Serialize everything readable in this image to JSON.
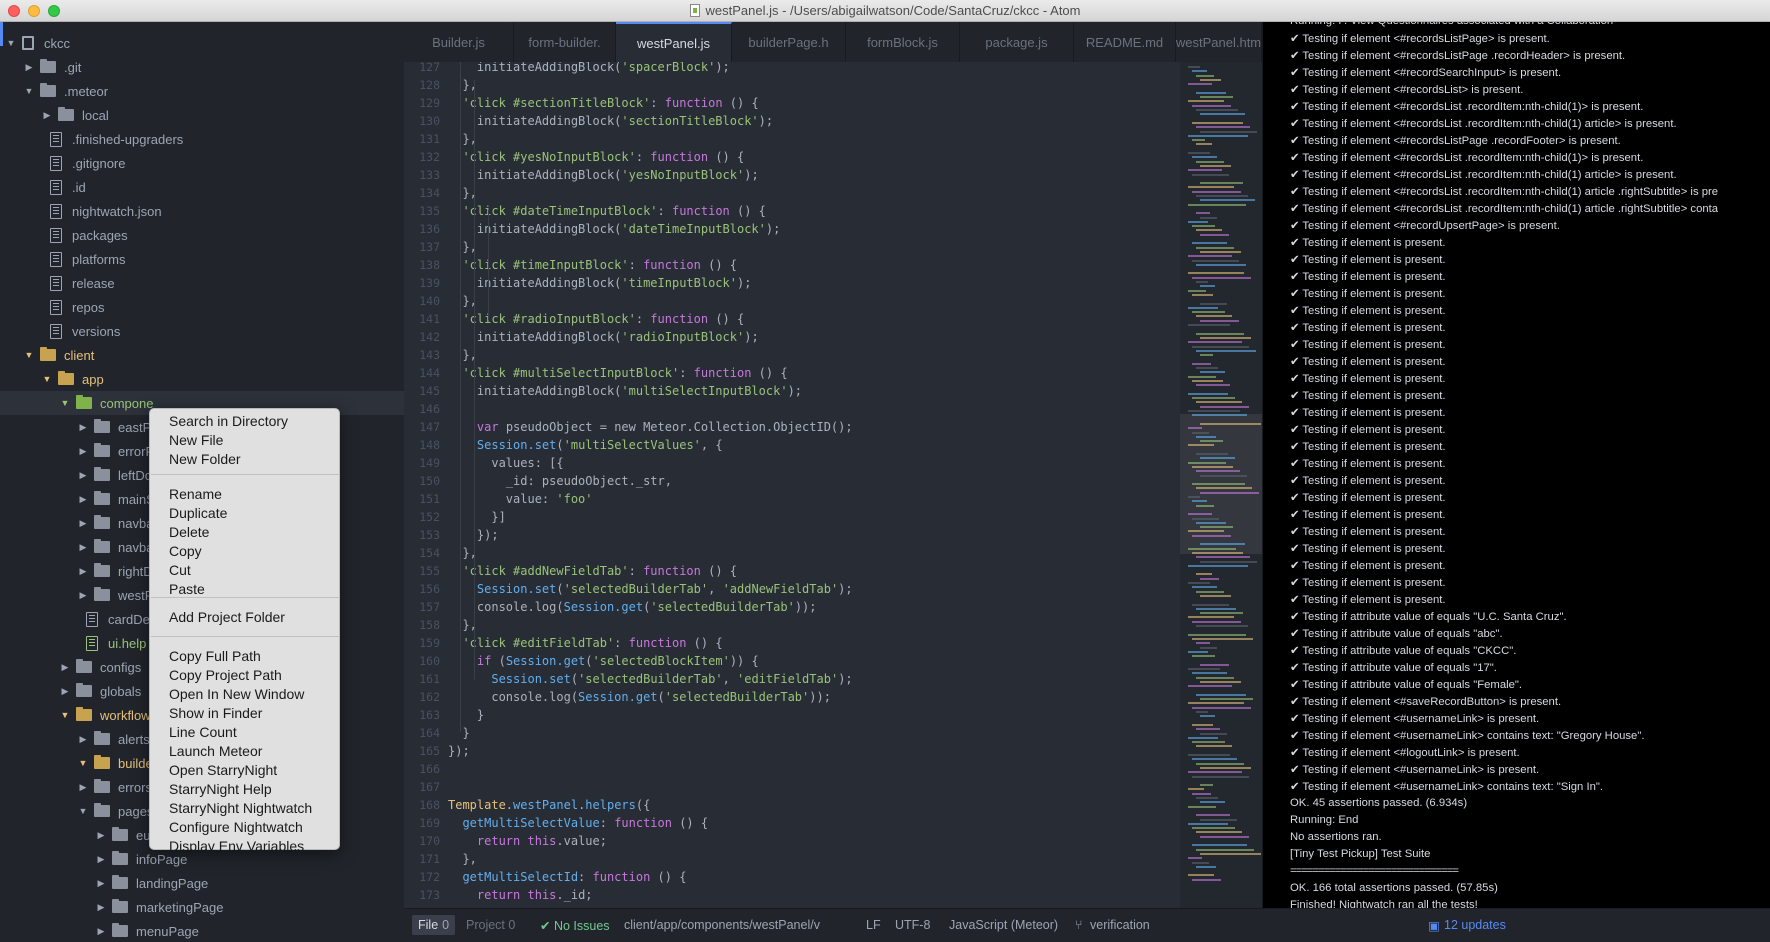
{
  "window": {
    "title": "westPanel.js - /Users/abigailwatson/Code/SantaCruz/ckcc - Atom"
  },
  "tree": {
    "items": [
      {
        "label": "ckcc",
        "kind": "root"
      },
      {
        "label": ".git",
        "kind": "folder-closed"
      },
      {
        "label": ".meteor",
        "kind": "folder-open"
      },
      {
        "label": "local",
        "kind": "folder-closed"
      },
      {
        "label": ".finished-upgraders",
        "kind": "file"
      },
      {
        "label": ".gitignore",
        "kind": "file"
      },
      {
        "label": ".id",
        "kind": "file"
      },
      {
        "label": "nightwatch.json",
        "kind": "file"
      },
      {
        "label": "packages",
        "kind": "file"
      },
      {
        "label": "platforms",
        "kind": "file"
      },
      {
        "label": "release",
        "kind": "file"
      },
      {
        "label": "repos",
        "kind": "file"
      },
      {
        "label": "versions",
        "kind": "file"
      },
      {
        "label": "client",
        "kind": "folder-open"
      },
      {
        "label": "app",
        "kind": "folder-open"
      },
      {
        "label": "compone",
        "kind": "folder-open"
      },
      {
        "label": "eastPa",
        "kind": "folder-closed"
      },
      {
        "label": "errorP",
        "kind": "folder-closed"
      },
      {
        "label": "leftDoc",
        "kind": "folder-closed"
      },
      {
        "label": "mainSl",
        "kind": "folder-closed"
      },
      {
        "label": "navbar",
        "kind": "folder-closed"
      },
      {
        "label": "navbar",
        "kind": "folder-closed"
      },
      {
        "label": "rightDo",
        "kind": "folder-closed"
      },
      {
        "label": "westPa",
        "kind": "folder-closed"
      },
      {
        "label": "cardDe",
        "kind": "file"
      },
      {
        "label": "ui.help",
        "kind": "file"
      },
      {
        "label": "configs",
        "kind": "folder-closed"
      },
      {
        "label": "globals",
        "kind": "folder-closed"
      },
      {
        "label": "workflows",
        "kind": "folder-open"
      },
      {
        "label": "alerts",
        "kind": "folder-closed"
      },
      {
        "label": "builde",
        "kind": "folder-open"
      },
      {
        "label": "errors",
        "kind": "folder-closed"
      },
      {
        "label": "pages",
        "kind": "folder-open"
      },
      {
        "label": "eula",
        "kind": "folder-closed"
      },
      {
        "label": "infoPage",
        "kind": "folder-closed"
      },
      {
        "label": "landingPage",
        "kind": "folder-closed"
      },
      {
        "label": "marketingPage",
        "kind": "folder-closed"
      },
      {
        "label": "menuPage",
        "kind": "folder-closed"
      }
    ]
  },
  "tabs": [
    "Builder.js",
    "form-builder.",
    "westPanel.js",
    "builderPage.h",
    "formBlock.js",
    "package.js",
    "README.md",
    "westPanel.htm"
  ],
  "active_tab": "westPanel.js",
  "editor": {
    "lines": [
      {
        "n": "127",
        "segs": [
          [
            "    initiateAddingBlock(",
            ""
          ],
          [
            "'spacerBlock'",
            "s"
          ],
          [
            ");",
            ""
          ]
        ]
      },
      {
        "n": "128",
        "segs": [
          [
            "  },",
            ""
          ]
        ]
      },
      {
        "n": "129",
        "segs": [
          [
            "  ",
            ""
          ],
          [
            "'click #sectionTitleBlock'",
            "s"
          ],
          [
            ": ",
            ""
          ],
          [
            "function",
            "k"
          ],
          [
            " () {",
            ""
          ]
        ]
      },
      {
        "n": "130",
        "segs": [
          [
            "    initiateAddingBlock(",
            ""
          ],
          [
            "'sectionTitleBlock'",
            "s"
          ],
          [
            ");",
            ""
          ]
        ]
      },
      {
        "n": "131",
        "segs": [
          [
            "  },",
            ""
          ]
        ]
      },
      {
        "n": "132",
        "segs": [
          [
            "  ",
            ""
          ],
          [
            "'click #yesNoInputBlock'",
            "s"
          ],
          [
            ": ",
            ""
          ],
          [
            "function",
            "k"
          ],
          [
            " () {",
            ""
          ]
        ]
      },
      {
        "n": "133",
        "segs": [
          [
            "    initiateAddingBlock(",
            ""
          ],
          [
            "'yesNoInputBlock'",
            "s"
          ],
          [
            ");",
            ""
          ]
        ]
      },
      {
        "n": "134",
        "segs": [
          [
            "  },",
            ""
          ]
        ]
      },
      {
        "n": "135",
        "segs": [
          [
            "  ",
            ""
          ],
          [
            "'click #dateTimeInputBlock'",
            "s"
          ],
          [
            ": ",
            ""
          ],
          [
            "function",
            "k"
          ],
          [
            " () {",
            ""
          ]
        ]
      },
      {
        "n": "136",
        "segs": [
          [
            "    initiateAddingBlock(",
            ""
          ],
          [
            "'dateTimeInputBlock'",
            "s"
          ],
          [
            ");",
            ""
          ]
        ]
      },
      {
        "n": "137",
        "segs": [
          [
            "  },",
            ""
          ]
        ]
      },
      {
        "n": "138",
        "segs": [
          [
            "  ",
            ""
          ],
          [
            "'click #timeInputBlock'",
            "s"
          ],
          [
            ": ",
            ""
          ],
          [
            "function",
            "k"
          ],
          [
            " () {",
            ""
          ]
        ]
      },
      {
        "n": "139",
        "segs": [
          [
            "    initiateAddingBlock(",
            ""
          ],
          [
            "'timeInputBlock'",
            "s"
          ],
          [
            ");",
            ""
          ]
        ]
      },
      {
        "n": "140",
        "segs": [
          [
            "  },",
            ""
          ]
        ]
      },
      {
        "n": "141",
        "segs": [
          [
            "  ",
            ""
          ],
          [
            "'click #radioInputBlock'",
            "s"
          ],
          [
            ": ",
            ""
          ],
          [
            "function",
            "k"
          ],
          [
            " () {",
            ""
          ]
        ]
      },
      {
        "n": "142",
        "segs": [
          [
            "    initiateAddingBlock(",
            ""
          ],
          [
            "'radioInputBlock'",
            "s"
          ],
          [
            ");",
            ""
          ]
        ]
      },
      {
        "n": "143",
        "segs": [
          [
            "  },",
            ""
          ]
        ]
      },
      {
        "n": "144",
        "segs": [
          [
            "  ",
            ""
          ],
          [
            "'click #multiSelectInputBlock'",
            "s"
          ],
          [
            ": ",
            ""
          ],
          [
            "function",
            "k"
          ],
          [
            " () {",
            ""
          ]
        ]
      },
      {
        "n": "145",
        "segs": [
          [
            "    initiateAddingBlock(",
            ""
          ],
          [
            "'multiSelectInputBlock'",
            "s"
          ],
          [
            ");",
            ""
          ]
        ]
      },
      {
        "n": "146",
        "segs": [
          [
            "",
            ""
          ]
        ]
      },
      {
        "n": "147",
        "segs": [
          [
            "    ",
            ""
          ],
          [
            "var",
            "k"
          ],
          [
            " pseudoObject = new Meteor.Collection.ObjectID();",
            ""
          ]
        ]
      },
      {
        "n": "148",
        "segs": [
          [
            "    ",
            ""
          ],
          [
            "Session.set",
            "b"
          ],
          [
            "(",
            ""
          ],
          [
            "'multiSelectValues'",
            "s"
          ],
          [
            ", {",
            ""
          ]
        ]
      },
      {
        "n": "149",
        "segs": [
          [
            "      values: [{",
            ""
          ]
        ]
      },
      {
        "n": "150",
        "segs": [
          [
            "        _id: pseudoObject._str,",
            ""
          ]
        ]
      },
      {
        "n": "151",
        "segs": [
          [
            "        value: ",
            ""
          ],
          [
            "'foo'",
            "s"
          ]
        ]
      },
      {
        "n": "152",
        "segs": [
          [
            "      }]",
            ""
          ]
        ]
      },
      {
        "n": "153",
        "segs": [
          [
            "    });",
            ""
          ]
        ]
      },
      {
        "n": "154",
        "segs": [
          [
            "  },",
            ""
          ]
        ]
      },
      {
        "n": "155",
        "segs": [
          [
            "  ",
            ""
          ],
          [
            "'click #addNewFieldTab'",
            "s"
          ],
          [
            ": ",
            ""
          ],
          [
            "function",
            "k"
          ],
          [
            " () {",
            ""
          ]
        ]
      },
      {
        "n": "156",
        "segs": [
          [
            "    ",
            ""
          ],
          [
            "Session.set",
            "b"
          ],
          [
            "(",
            ""
          ],
          [
            "'selectedBuilderTab'",
            "s"
          ],
          [
            ", ",
            ""
          ],
          [
            "'addNewFieldTab'",
            "s"
          ],
          [
            ");",
            ""
          ]
        ]
      },
      {
        "n": "157",
        "segs": [
          [
            "    console.log(",
            ""
          ],
          [
            "Session.get",
            "b"
          ],
          [
            "(",
            ""
          ],
          [
            "'selectedBuilderTab'",
            "s"
          ],
          [
            "));",
            ""
          ]
        ]
      },
      {
        "n": "158",
        "segs": [
          [
            "  },",
            ""
          ]
        ]
      },
      {
        "n": "159",
        "segs": [
          [
            "  ",
            ""
          ],
          [
            "'click #editFieldTab'",
            "s"
          ],
          [
            ": ",
            ""
          ],
          [
            "function",
            "k"
          ],
          [
            " () {",
            ""
          ]
        ]
      },
      {
        "n": "160",
        "segs": [
          [
            "    ",
            ""
          ],
          [
            "if",
            "k"
          ],
          [
            " (",
            ""
          ],
          [
            "Session.get",
            "b"
          ],
          [
            "(",
            ""
          ],
          [
            "'selectedBlockItem'",
            "s"
          ],
          [
            ")) {",
            ""
          ]
        ]
      },
      {
        "n": "161",
        "segs": [
          [
            "      ",
            ""
          ],
          [
            "Session.set",
            "b"
          ],
          [
            "(",
            ""
          ],
          [
            "'selectedBuilderTab'",
            "s"
          ],
          [
            ", ",
            ""
          ],
          [
            "'editFieldTab'",
            "s"
          ],
          [
            ");",
            ""
          ]
        ]
      },
      {
        "n": "162",
        "segs": [
          [
            "      console.log(",
            ""
          ],
          [
            "Session.get",
            "b"
          ],
          [
            "(",
            ""
          ],
          [
            "'selectedBuilderTab'",
            "s"
          ],
          [
            "));",
            ""
          ]
        ]
      },
      {
        "n": "163",
        "segs": [
          [
            "    }",
            ""
          ]
        ]
      },
      {
        "n": "164",
        "segs": [
          [
            "  }",
            ""
          ]
        ]
      },
      {
        "n": "165",
        "segs": [
          [
            "});",
            ""
          ]
        ]
      },
      {
        "n": "166",
        "segs": [
          [
            "",
            ""
          ]
        ]
      },
      {
        "n": "167",
        "segs": [
          [
            "",
            ""
          ]
        ]
      },
      {
        "n": "168",
        "segs": [
          [
            "Template",
            "y"
          ],
          [
            ".",
            ""
          ],
          [
            "westPanel",
            "b"
          ],
          [
            ".",
            ""
          ],
          [
            "helpers",
            "b"
          ],
          [
            "({",
            ""
          ]
        ]
      },
      {
        "n": "169",
        "segs": [
          [
            "  ",
            ""
          ],
          [
            "getMultiSelectValue",
            "b"
          ],
          [
            ": ",
            ""
          ],
          [
            "function",
            "k"
          ],
          [
            " () {",
            ""
          ]
        ]
      },
      {
        "n": "170",
        "segs": [
          [
            "    ",
            ""
          ],
          [
            "return",
            "k"
          ],
          [
            " ",
            ""
          ],
          [
            "this",
            "k"
          ],
          [
            ".value;",
            ""
          ]
        ]
      },
      {
        "n": "171",
        "segs": [
          [
            "  },",
            ""
          ]
        ]
      },
      {
        "n": "172",
        "segs": [
          [
            "  ",
            ""
          ],
          [
            "getMultiSelectId",
            "b"
          ],
          [
            ": ",
            ""
          ],
          [
            "function",
            "k"
          ],
          [
            " () {",
            ""
          ]
        ]
      },
      {
        "n": "173",
        "segs": [
          [
            "    ",
            ""
          ],
          [
            "return",
            "k"
          ],
          [
            " ",
            ""
          ],
          [
            "this",
            "k"
          ],
          [
            "._id;",
            ""
          ]
        ]
      }
    ]
  },
  "results": [
    "Running: F. View Questionnaires associated with a Collaboration",
    "✔ Testing if element <#recordsListPage> is present.",
    "✔ Testing if element <#recordsListPage .recordHeader> is present.",
    "✔ Testing if element <#recordSearchInput> is present.",
    "✔ Testing if element <#recordsList> is present.",
    "✔ Testing if element <#recordsList .recordItem:nth-child(1)> is present.",
    "✔ Testing if element <#recordsList .recordItem:nth-child(1) article> is present.",
    "✔ Testing if element <#recordsListPage .recordFooter> is present.",
    "✔ Testing if element <#recordsList .recordItem:nth-child(1)> is present.",
    "✔ Testing if element <#recordsList .recordItem:nth-child(1) article> is present.",
    "✔ Testing if element <#recordsList .recordItem:nth-child(1) article .rightSubtitle> is pre",
    "✔ Testing if element <#recordsList .recordItem:nth-child(1) article .rightSubtitle> conta",
    "✔ Testing if element <#recordUpsertPage> is present.",
    "✔ Testing if element is present.",
    "✔ Testing if element is present.",
    "✔ Testing if element is present.",
    "✔ Testing if element is present.",
    "✔ Testing if element is present.",
    "✔ Testing if element is present.",
    "✔ Testing if element is present.",
    "✔ Testing if element is present.",
    "✔ Testing if element is present.",
    "✔ Testing if element is present.",
    "✔ Testing if element is present.",
    "✔ Testing if element is present.",
    "✔ Testing if element is present.",
    "✔ Testing if element is present.",
    "✔ Testing if element is present.",
    "✔ Testing if element is present.",
    "✔ Testing if element is present.",
    "✔ Testing if element is present.",
    "✔ Testing if element is present.",
    "✔ Testing if element is present.",
    "✔ Testing if element is present.",
    "✔ Testing if element is present.",
    "✔ Testing if attribute value of equals \"U.C. Santa Cruz\".",
    "✔ Testing if attribute value of equals \"abc\".",
    "✔ Testing if attribute value of equals \"CKCC\".",
    "✔ Testing if attribute value of equals \"17\".",
    "✔ Testing if attribute value of equals \"Female\".",
    "✔ Testing if element <#saveRecordButton> is present.",
    "✔ Testing if element <#usernameLink> is present.",
    "✔ Testing if element <#usernameLink> contains text: \"Gregory House\".",
    "✔ Testing if element <#logoutLink> is present.",
    "✔ Testing if element <#usernameLink> is present.",
    "✔ Testing if element <#usernameLink> contains text: \"Sign In\".",
    "OK. 45 assertions passed. (6.934s)",
    "Running: End",
    "No assertions ran.",
    "[Tiny Test Pickup] Test Suite",
    "==============================",
    "OK. 166 total assertions passed. (57.85s)",
    "Finished! Nightwatch ran all the tests!"
  ],
  "statusbar": {
    "file_label": "File",
    "file_count": "0",
    "project_label": "Project",
    "project_count": "0",
    "issues": "✔ No Issues",
    "path": "client/app/components/westPanel/v",
    "line_ending": "LF",
    "encoding": "UTF-8",
    "grammar": "JavaScript (Meteor)",
    "branch": "verification",
    "updates": "12 updates"
  },
  "context_menu": {
    "groups": [
      [
        "Search in Directory",
        "New File",
        "New Folder"
      ],
      [
        "Rename",
        "Duplicate",
        "Delete",
        "Copy",
        "Cut",
        "Paste"
      ],
      [
        "Add Project Folder"
      ],
      [
        "Copy Full Path",
        "Copy Project Path",
        "Open In New Window",
        "Show in Finder",
        "Line Count",
        "Launch Meteor",
        "Open StarryNight",
        "StarryNight Help",
        "StarryNight Nightwatch",
        "Configure Nightwatch",
        "Display Env Variables"
      ]
    ]
  },
  "colors": {
    "accent": "#568af2",
    "string": "#98c379",
    "keyword": "#c678dd",
    "function": "#61afef",
    "folder_highlight": "#e5c07b"
  }
}
